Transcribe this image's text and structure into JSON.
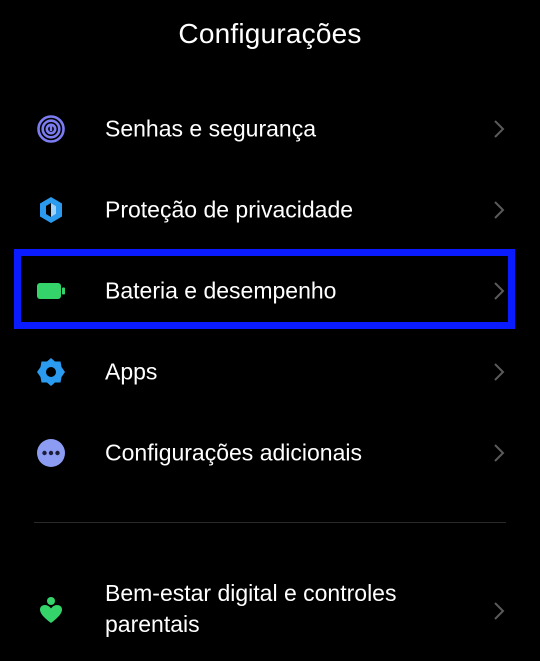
{
  "header": {
    "title": "Configurações"
  },
  "settings": {
    "items": [
      {
        "label": "Senhas e segurança",
        "icon": "fingerprint-icon"
      },
      {
        "label": "Proteção de privacidade",
        "icon": "privacy-shield-icon"
      },
      {
        "label": "Bateria e desempenho",
        "icon": "battery-icon"
      },
      {
        "label": "Apps",
        "icon": "gear-icon"
      },
      {
        "label": "Configurações adicionais",
        "icon": "more-dots-icon"
      }
    ],
    "extra_items": [
      {
        "label": "Bem-estar digital e controles parentais",
        "icon": "digital-wellbeing-icon"
      }
    ]
  },
  "colors": {
    "background": "#000000",
    "text": "#ffffff",
    "chevron": "#5a5a5a",
    "highlight": "#0a1cff",
    "fingerprint": "#7b7cf0",
    "privacy": "#2b9bf0",
    "battery": "#35d46b",
    "gear": "#2b9bf0",
    "more": "#8c9cf2",
    "wellbeing": "#35d46b"
  }
}
